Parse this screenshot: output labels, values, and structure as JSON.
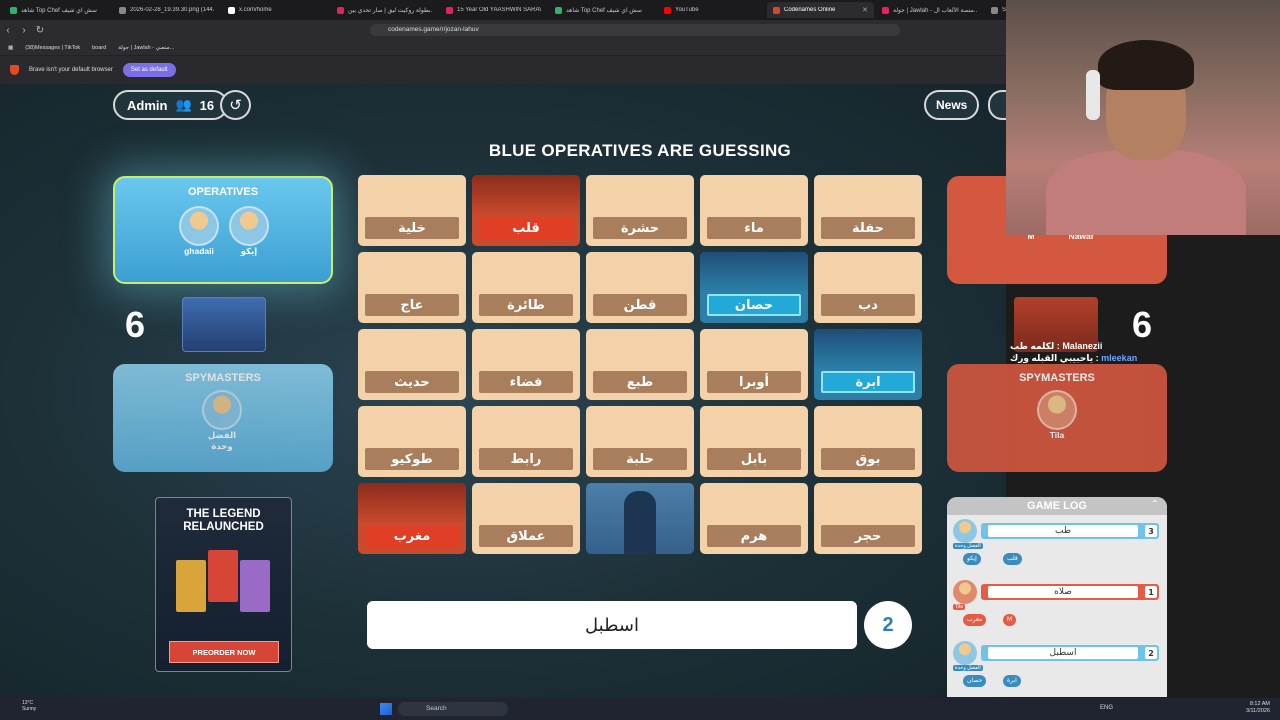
{
  "browser": {
    "tabs": [
      {
        "label": "شاهد Top Chef سش آي شيف",
        "color": "#2fb36b"
      },
      {
        "label": "2026-02-28_19.39.30.png (144...",
        "color": "#888888"
      },
      {
        "label": "x.com/home",
        "color": "#ffffff"
      },
      {
        "label": "بطولة روكيت ليق | صار تحدي بين...",
        "color": "#e0245e"
      },
      {
        "label": "15 Year Old YAASHWIN SARAV...",
        "color": "#e0245e"
      },
      {
        "label": "شاهد Top Chef سش آي شيف",
        "color": "#2fb36b"
      },
      {
        "label": "YouTube",
        "color": "#ff0000"
      },
      {
        "label": "Codenames Online",
        "color": "#d44a2e",
        "active": true
      },
      {
        "label": "جولة | Jawlah - منصة الألعاب ال...",
        "color": "#e0245e"
      },
      {
        "label": "Settings - ...",
        "color": "#888888"
      }
    ],
    "url": "codenames.game/r/jozan-lahuv",
    "bookmarks": [
      "(38)Messages | TikTok",
      "board",
      "جولة | Jawlah - منصي..."
    ],
    "infobar_text": "Brave isn't your default browser",
    "infobar_button": "Set as default"
  },
  "game": {
    "admin_label": "Admin",
    "player_count": "16",
    "news_label": "News",
    "status": "BLUE OPERATIVES ARE GUESSING",
    "blue": {
      "operatives_title": "OPERATIVES",
      "operatives": [
        "ghadaii",
        "إيكو"
      ],
      "score": "6",
      "spymasters_title": "SPYMASTERS",
      "spymasters": [
        "الفضل وحدة"
      ]
    },
    "red": {
      "operatives": [
        "M",
        "Nawaf"
      ],
      "score": "6",
      "spymasters_title": "SPYMASTERS",
      "spymasters": [
        "Tila"
      ]
    },
    "board": [
      {
        "word": "خلية",
        "state": "hidden"
      },
      {
        "word": "قلب",
        "state": "red"
      },
      {
        "word": "حشرة",
        "state": "hidden"
      },
      {
        "word": "ماء",
        "state": "hidden"
      },
      {
        "word": "حفلة",
        "state": "hidden"
      },
      {
        "word": "عاج",
        "state": "hidden"
      },
      {
        "word": "طائرة",
        "state": "hidden"
      },
      {
        "word": "قطن",
        "state": "hidden"
      },
      {
        "word": "حصان",
        "state": "blue"
      },
      {
        "word": "دب",
        "state": "hidden"
      },
      {
        "word": "حديث",
        "state": "hidden"
      },
      {
        "word": "فضاء",
        "state": "hidden"
      },
      {
        "word": "طبع",
        "state": "hidden"
      },
      {
        "word": "أوبرا",
        "state": "hidden"
      },
      {
        "word": "ابرة",
        "state": "blue"
      },
      {
        "word": "طوكيو",
        "state": "hidden"
      },
      {
        "word": "رابط",
        "state": "hidden"
      },
      {
        "word": "حلبة",
        "state": "hidden"
      },
      {
        "word": "بابل",
        "state": "hidden"
      },
      {
        "word": "بوق",
        "state": "hidden"
      },
      {
        "word": "مغرب",
        "state": "red"
      },
      {
        "word": "عملاق",
        "state": "hidden"
      },
      {
        "word": "",
        "state": "blue-covered"
      },
      {
        "word": "هرم",
        "state": "hidden"
      },
      {
        "word": "حجر",
        "state": "hidden"
      }
    ],
    "clue": {
      "word": "اسطبل",
      "number": "2"
    },
    "promo": {
      "title_line1": "THE LEGEND",
      "title_line2": "RELAUNCHED",
      "button": "PREORDER NOW"
    },
    "log": {
      "title": "GAME LOG",
      "entries": [
        {
          "team": "blue",
          "player": "الفضل وحدة",
          "clue": "طب",
          "number": "3",
          "guesses": [
            "إيكو",
            "قلب"
          ]
        },
        {
          "team": "red",
          "player": "Tila",
          "clue": "صلاه",
          "number": "1",
          "guesses": [
            "مغرب",
            "M"
          ]
        },
        {
          "team": "blue",
          "player": "الفضل وحدة",
          "clue": "اسطبل",
          "number": "2",
          "guesses": [
            "حصان",
            "ابرة"
          ]
        }
      ]
    }
  },
  "chat": {
    "lines": [
      {
        "user": "Malanezii",
        "text": "لكلمه طب :"
      },
      {
        "user": "mleekan",
        "text": "ياحبيبي القبله ورك :"
      }
    ]
  },
  "taskbar": {
    "weather_temp": "13°C",
    "weather_desc": "Sunny",
    "search_placeholder": "Search",
    "lang": "ENG",
    "time": "8:12 AM",
    "date": "3/11/2026"
  }
}
